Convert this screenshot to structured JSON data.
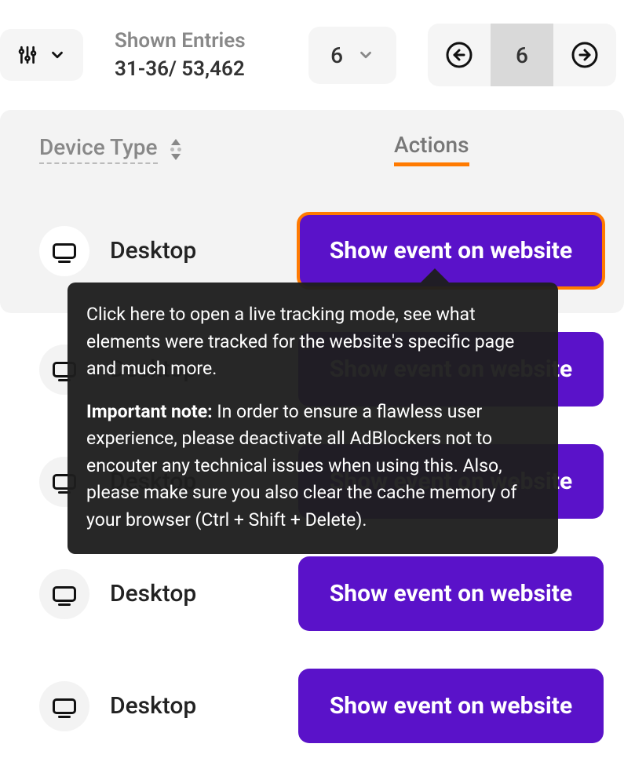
{
  "toolbar": {
    "shown_label": "Shown Entries",
    "shown_value": "31-36/ 53,462",
    "page_size": "6",
    "current_page": "6"
  },
  "headers": {
    "device": "Device Type",
    "actions": "Actions"
  },
  "rows": [
    {
      "device": "Desktop",
      "action": "Show event on website"
    },
    {
      "device": "Desktop",
      "action": "Show event on website"
    },
    {
      "device": "Desktop",
      "action": "Show event on website"
    },
    {
      "device": "Desktop",
      "action": "Show event on website"
    },
    {
      "device": "Desktop",
      "action": "Show event on website"
    }
  ],
  "tooltip": {
    "p1": "Click here to open a live tracking mode, see what elements were tracked for the website's specific page and much more.",
    "strong": "Important note:",
    "p2": " In order to ensure a flawless user experience, please deactivate all AdBlockers not to encouter any technical issues when using this. Also, please make sure you also clear the cache memory of your browser (Ctrl + Shift + Delete)."
  }
}
